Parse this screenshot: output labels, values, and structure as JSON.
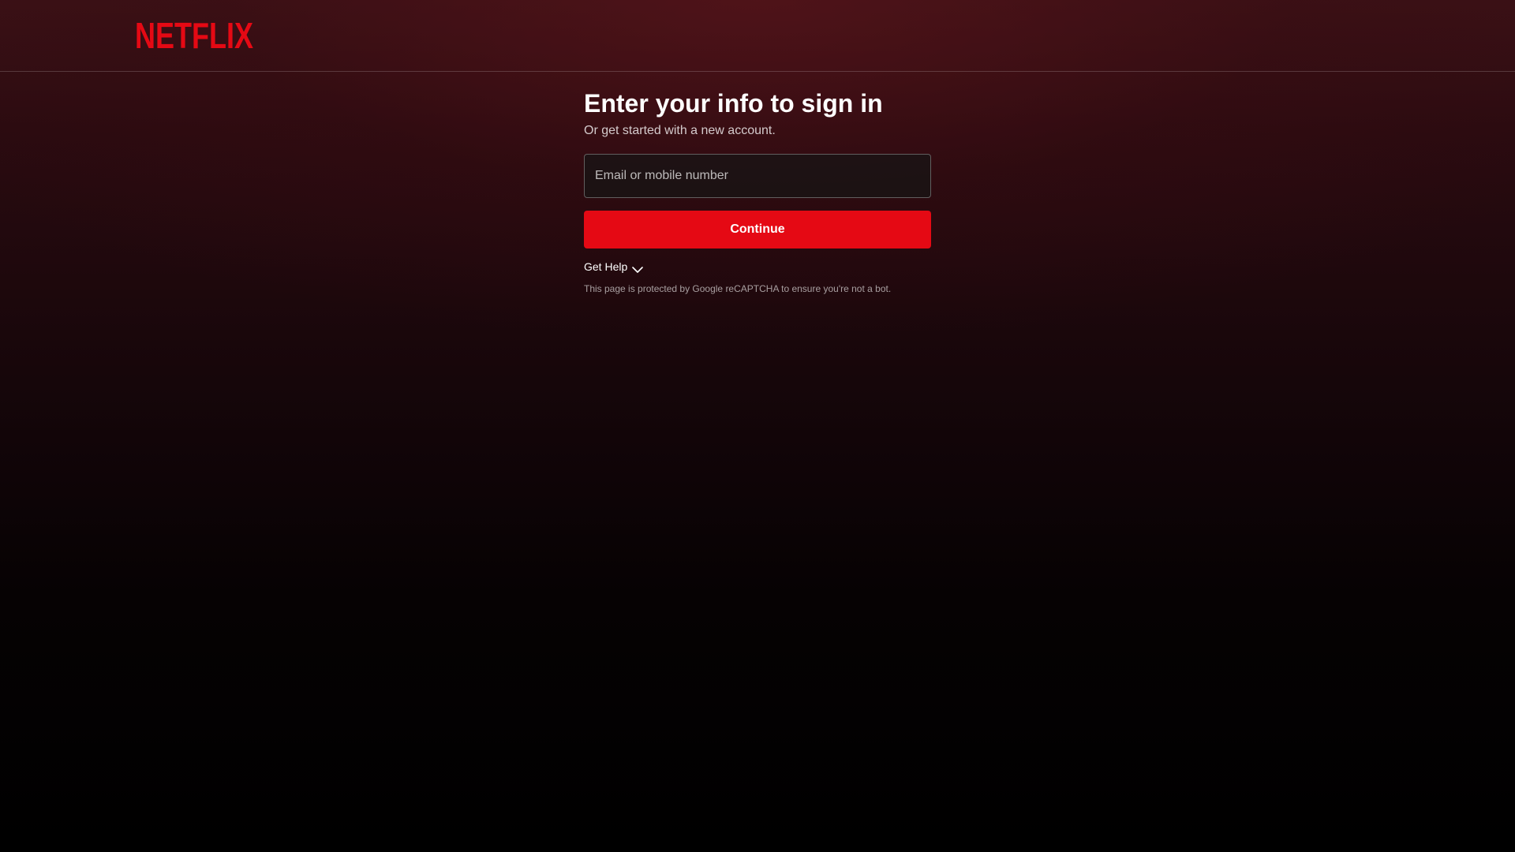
{
  "header": {
    "logo_text": "NETFLIX",
    "brand_color": "#e50914"
  },
  "signin": {
    "title": "Enter your info to sign in",
    "subtitle": "Or get started with a new account.",
    "email_placeholder": "Email or mobile number",
    "email_value": "",
    "continue_label": "Continue",
    "help_label": "Get Help",
    "help_icon": "chevron-down-icon",
    "recaptcha_notice": "This page is protected by Google reCAPTCHA to ensure you're not a bot."
  }
}
